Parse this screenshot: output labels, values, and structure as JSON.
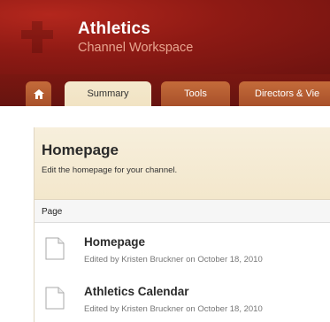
{
  "header": {
    "title": "Athletics",
    "subtitle": "Channel Workspace"
  },
  "tabs": [
    {
      "label": "",
      "icon": "home-icon"
    },
    {
      "label": "Summary"
    },
    {
      "label": "Tools"
    },
    {
      "label": "Directors & Vie"
    }
  ],
  "colors": {
    "header": "#8e1a14",
    "tab": "#b05a30",
    "active_tab": "#f3e7cc"
  },
  "panel": {
    "title": "Homepage",
    "description": "Edit the homepage for your channel.",
    "column_header": "Page",
    "rows": [
      {
        "title": "Homepage",
        "meta": "Edited by Kristen Bruckner on October 18, 2010",
        "icon": "document-icon"
      },
      {
        "title": "Athletics Calendar",
        "meta": "Edited by Kristen Bruckner on October 18, 2010",
        "icon": "document-icon"
      }
    ]
  }
}
